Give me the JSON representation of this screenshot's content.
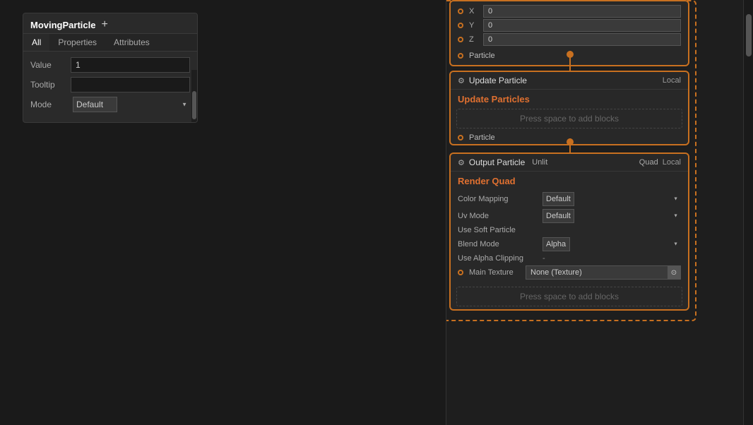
{
  "leftPanel": {
    "title": "MovingParticle",
    "plusLabel": "+",
    "tabs": [
      {
        "label": "All",
        "active": true
      },
      {
        "label": "Properties",
        "active": false
      },
      {
        "label": "Attributes",
        "active": false
      }
    ],
    "fields": {
      "valueLabel": "Value",
      "valueInput": "1",
      "tooltipLabel": "Tooltip",
      "tooltipInput": "",
      "modeLabel": "Mode",
      "modeValue": "Default"
    }
  },
  "nodeArea": {
    "topCard": {
      "xyzRows": [
        {
          "axis": "X",
          "value": "0"
        },
        {
          "axis": "Y",
          "value": "0"
        },
        {
          "axis": "Z",
          "value": "0"
        }
      ],
      "particleLabel": "Particle"
    },
    "updateCard": {
      "icon": "⚙",
      "title": "Update Particle",
      "localLabel": "Local",
      "subtitle": "Update Particles",
      "pressSpace": "Press space to add blocks",
      "particleLabel": "Particle"
    },
    "outputCard": {
      "icon": "⚙",
      "title": "Output Particle",
      "unlit": "Unlit",
      "quad": "Quad",
      "localLabel": "Local",
      "subtitle": "Render Quad",
      "fields": [
        {
          "label": "Color Mapping",
          "value": "Default",
          "type": "select"
        },
        {
          "label": "Uv Mode",
          "value": "Default",
          "type": "select"
        },
        {
          "label": "Use Soft Particle",
          "value": "",
          "type": "text"
        },
        {
          "label": "Blend Mode",
          "value": "Alpha",
          "type": "select"
        },
        {
          "label": "Use Alpha Clipping",
          "value": "-",
          "type": "text"
        }
      ],
      "textureRow": {
        "label": "Main Texture",
        "value": "None (Texture)"
      },
      "pressSpace": "Press space to add blocks"
    }
  },
  "icons": {
    "settings": "⚙",
    "local": "Local",
    "chevron": "▼",
    "circle": "●"
  }
}
